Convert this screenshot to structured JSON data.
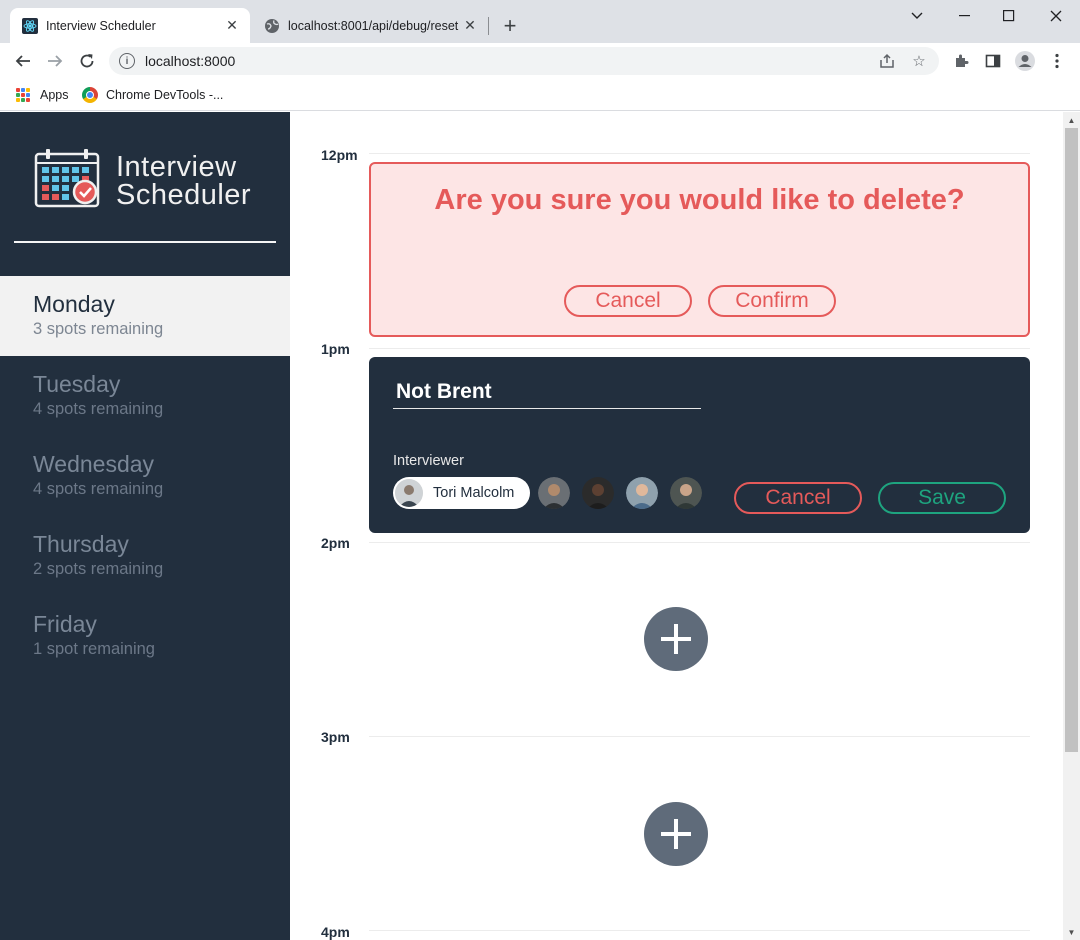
{
  "browser": {
    "tabs": [
      {
        "title": "Interview Scheduler",
        "active": true
      },
      {
        "title": "localhost:8001/api/debug/reset",
        "active": false
      }
    ],
    "url": "localhost:8000",
    "bookmarks": [
      {
        "label": "Apps"
      },
      {
        "label": "Chrome DevTools -..."
      }
    ]
  },
  "app": {
    "brand": {
      "line1": "Interview",
      "line2": "Scheduler"
    },
    "days": [
      {
        "name": "Monday",
        "spots": "3 spots remaining",
        "selected": true
      },
      {
        "name": "Tuesday",
        "spots": "4 spots remaining",
        "selected": false
      },
      {
        "name": "Wednesday",
        "spots": "4 spots remaining",
        "selected": false
      },
      {
        "name": "Thursday",
        "spots": "2 spots remaining",
        "selected": false
      },
      {
        "name": "Friday",
        "spots": "1 spot remaining",
        "selected": false
      }
    ],
    "times": [
      "12pm",
      "1pm",
      "2pm",
      "3pm",
      "4pm"
    ],
    "delete_confirm": {
      "message": "Are you sure you would like to delete?",
      "cancel_label": "Cancel",
      "confirm_label": "Confirm"
    },
    "form": {
      "student_name": "Not Brent",
      "interviewer_label": "Interviewer",
      "selected_interviewer": "Tori Malcolm",
      "cancel_label": "Cancel",
      "save_label": "Save"
    }
  },
  "colors": {
    "sidebar_bg": "#222f3e",
    "danger": "#e55a5a",
    "success": "#1ea47f",
    "add_button": "#5f6b7a"
  }
}
